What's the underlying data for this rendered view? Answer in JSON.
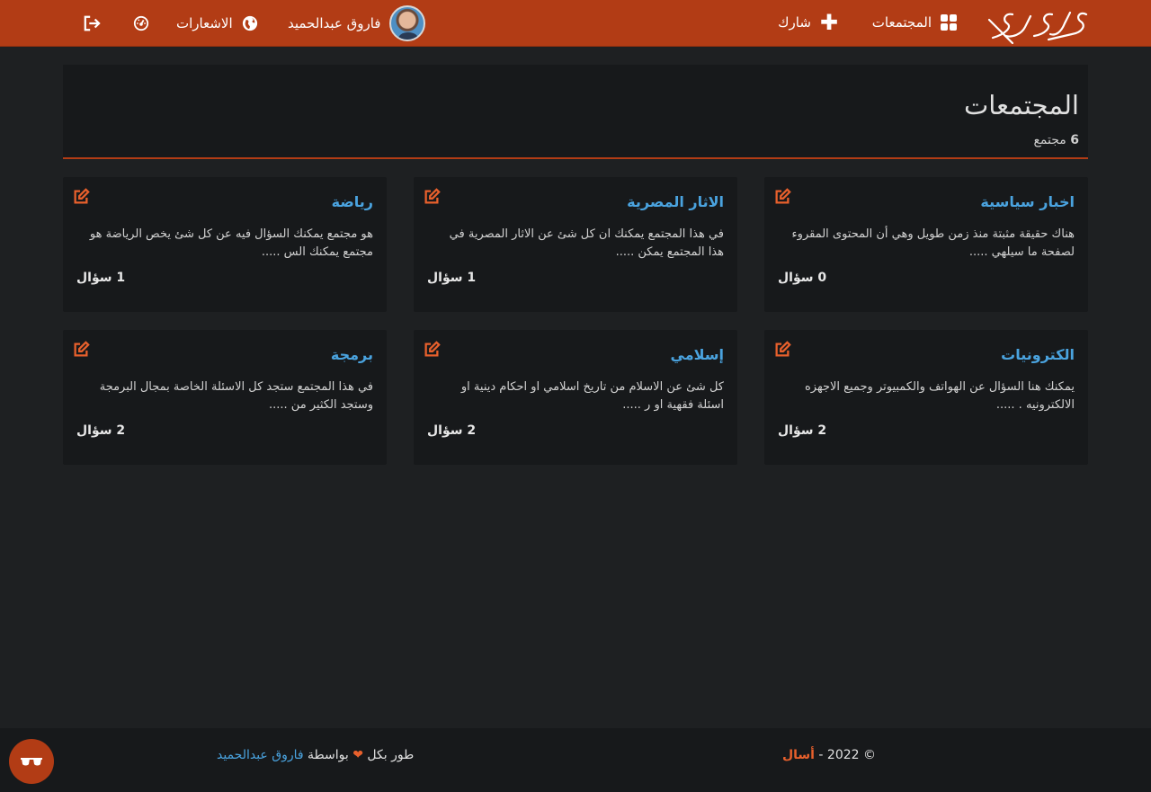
{
  "nav": {
    "communities_label": "المجتمعات",
    "share_label": "شارك",
    "user_name": "فاروق عبدالحميد",
    "notifications_label": "الاشعارات"
  },
  "header": {
    "title": "المجتمعات",
    "count_number": "6",
    "count_unit": "مجتمع"
  },
  "communities": [
    {
      "title": "اخبار سياسية",
      "description": "هناك حقيقة مثبتة منذ زمن طويل وهي أن المحتوى المقروء لصفحة ما سيلهي .....",
      "count": "0 سؤال"
    },
    {
      "title": "الاثار المصرية",
      "description": "في هذا المجتمع يمكنك ان كل شئ عن الاثار المصرية في هذا المجتمع يمكن .....",
      "count": "1 سؤال"
    },
    {
      "title": "رياضة",
      "description": "هو مجتمع يمكنك السؤال فيه عن كل شئ يخص الرياضة هو مجتمع يمكنك الس .....",
      "count": "1 سؤال"
    },
    {
      "title": "الكترونيات",
      "description": "يمكنك هنا السؤال عن الهواتف والكمبيوتر وجميع الاجهزه الالكترونيه . .....",
      "count": "2 سؤال"
    },
    {
      "title": "إسلامي",
      "description": "كل شئ عن الاسلام من تاريخ اسلامي او احكام دينية او اسئلة فقهية او ر .....",
      "count": "2 سؤال"
    },
    {
      "title": "برمجة",
      "description": "في هذا المجتمع ستجد كل الاسئلة الخاصة بمجال البرمجة وستجد الكثير من .....",
      "count": "2 سؤال"
    }
  ],
  "footer": {
    "copyright_symbol": "©",
    "year": "2022",
    "dash": "-",
    "brand": "أسال",
    "credit_prefix": "طور بكل",
    "credit_by": "بواسطة",
    "author": "فاروق عبدالحميد"
  },
  "colors": {
    "accent": "#b23c15",
    "link": "#4aa3df",
    "background": "#1e2022",
    "panel": "#17191b"
  }
}
